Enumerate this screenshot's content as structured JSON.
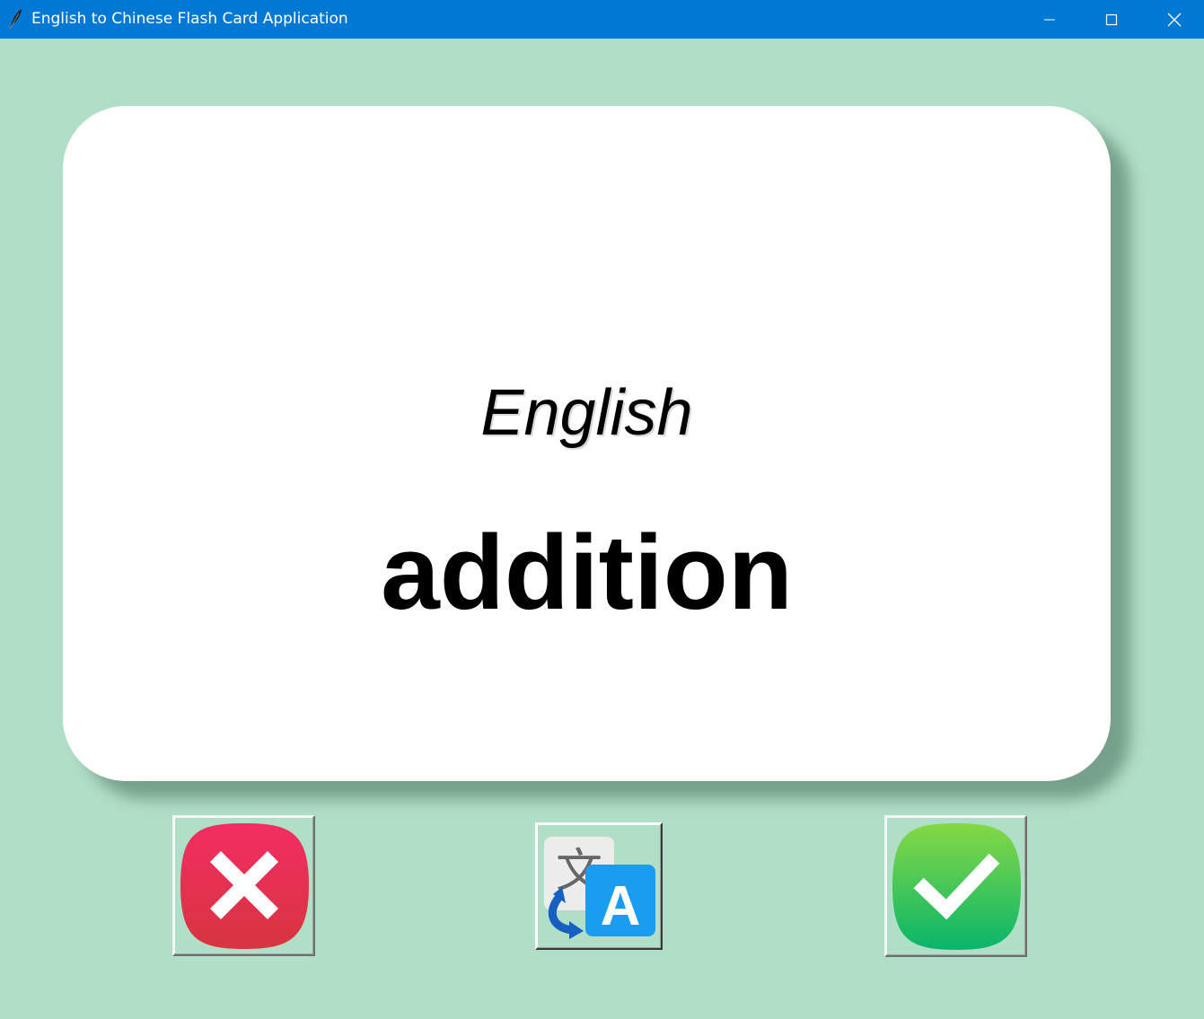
{
  "window": {
    "title": "English to Chinese Flash Card Application",
    "icon": "feather-icon"
  },
  "card": {
    "language": "English",
    "word": "addition"
  },
  "buttons": {
    "wrong": {
      "icon": "wrong-x-icon",
      "color": "#e8304f"
    },
    "flip": {
      "icon": "translate-icon",
      "color": "#1a9cf0"
    },
    "right": {
      "icon": "checkmark-icon",
      "color": "#2fc25a"
    }
  },
  "colors": {
    "background": "#b1dec7",
    "titlebar": "#0078d4",
    "card": "#ffffff"
  }
}
